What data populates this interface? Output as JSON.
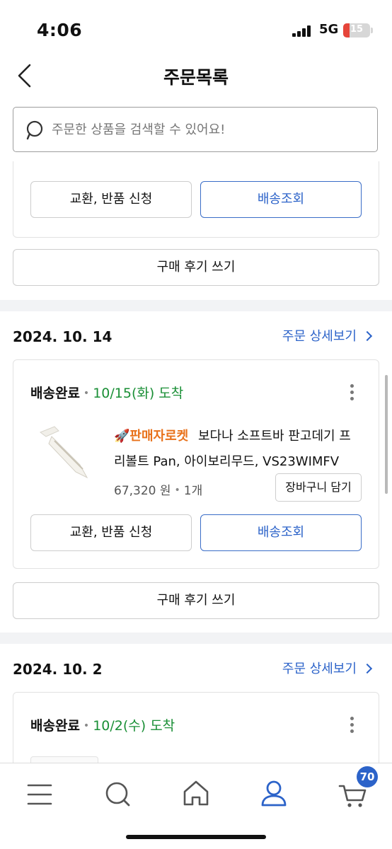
{
  "status_bar": {
    "time": "4:06",
    "network": "5G",
    "battery": "15"
  },
  "header": {
    "title": "주문목록"
  },
  "search": {
    "placeholder": "주문한 상품을 검색할 수 있어요!"
  },
  "partial_order": {
    "exchange_label": "교환, 반품 신청",
    "tracking_label": "배송조회",
    "review_label": "구매 후기 쓰기"
  },
  "orders": [
    {
      "date": "2024. 10. 14",
      "detail_link": "주문 상세보기",
      "status": "배송완료",
      "arrival": "10/15(화) 도착",
      "badge": "판매자로켓",
      "product_line1": "보다나 소프트바 판고데기 프",
      "product_line2": "리볼트 Pan, 아이보리무드, VS23WIMFV",
      "price": "67,320 원",
      "quantity": "1개",
      "cart_label": "장바구니 담기",
      "exchange_label": "교환, 반품 신청",
      "tracking_label": "배송조회",
      "review_label": "구매 후기 쓰기"
    },
    {
      "date": "2024. 10. 2",
      "detail_link": "주문 상세보기",
      "status": "배송완료",
      "arrival": "10/2(수) 도착"
    }
  ],
  "bottom_nav": {
    "items": [
      "menu-icon",
      "search-icon",
      "home-icon",
      "my-coupang-icon",
      "cart-icon"
    ],
    "cart_count": "70",
    "active_color": "#2c63c9"
  },
  "colors": {
    "accent_blue": "#2c63c9",
    "delivered_green": "#1a8f36",
    "rocket_orange": "#e8711a"
  }
}
